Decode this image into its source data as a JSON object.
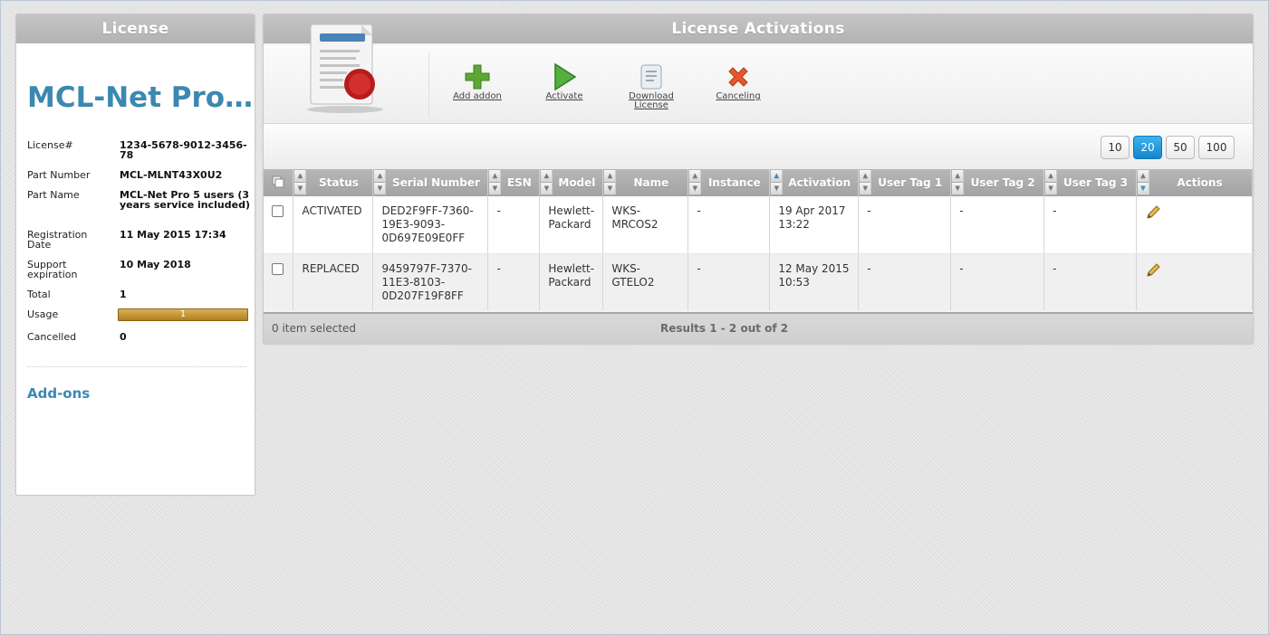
{
  "license_panel": {
    "title": "License",
    "product_name": "MCL-Net Pro…",
    "fields": [
      {
        "label": "License#",
        "value": "1234-5678-9012-3456-78"
      },
      {
        "label": "Part Number",
        "value": "MCL-MLNT43X0U2"
      },
      {
        "label": "Part Name",
        "value": "MCL-Net Pro 5 users (3 years service included)"
      },
      {
        "label": "Registration Date",
        "value": "11 May 2015 17:34"
      },
      {
        "label": "Support expiration",
        "value": "10 May 2018"
      },
      {
        "label": "Total",
        "value": "1"
      },
      {
        "label": "Usage",
        "value": "1"
      },
      {
        "label": "Cancelled",
        "value": "0"
      }
    ],
    "usage_fill_fraction": 1.0,
    "addons_title": "Add-ons"
  },
  "activations_panel": {
    "title": "License Activations",
    "toolbar": {
      "add_addon": "Add addon",
      "activate": "Activate",
      "download_license_line1": "Download",
      "download_license_line2": "License",
      "canceling": "Canceling"
    },
    "page_sizes": [
      "10",
      "20",
      "50",
      "100"
    ],
    "active_page_size": "20",
    "columns": [
      "Status",
      "Serial Number",
      "ESN",
      "Model",
      "Name",
      "Instance",
      "Activation",
      "User Tag 1",
      "User Tag 2",
      "User Tag 3",
      "Actions"
    ],
    "rows": [
      {
        "status": "ACTIVATED",
        "serial": "DED2F9FF-7360-19E3-9093-0D697E09E0FF",
        "esn": "-",
        "model": "Hewlett-Packard",
        "name": "WKS-MRCOS2",
        "instance": "-",
        "activation": "19 Apr 2017 13:22",
        "tag1": "-",
        "tag2": "-",
        "tag3": "-"
      },
      {
        "status": "REPLACED",
        "serial": "9459797F-7370-11E3-8103-0D207F19F8FF",
        "esn": "-",
        "model": "Hewlett-Packard",
        "name": "WKS-GTELO2",
        "instance": "-",
        "activation": "12 May 2015 10:53",
        "tag1": "-",
        "tag2": "-",
        "tag3": "-"
      }
    ],
    "selected_text": "0 item selected",
    "results_text": "Results 1 - 2 out of 2"
  },
  "colors": {
    "accent_blue": "#3b88b0",
    "active_page": "#1a8fd6",
    "usage_bar": "#c0922e",
    "header_gray": "#b3b3b3"
  },
  "icons": [
    "certificate-icon",
    "add-icon",
    "play-icon",
    "download-scroll-icon",
    "cancel-x-icon",
    "select-all-icon",
    "edit-pencil-icon"
  ]
}
